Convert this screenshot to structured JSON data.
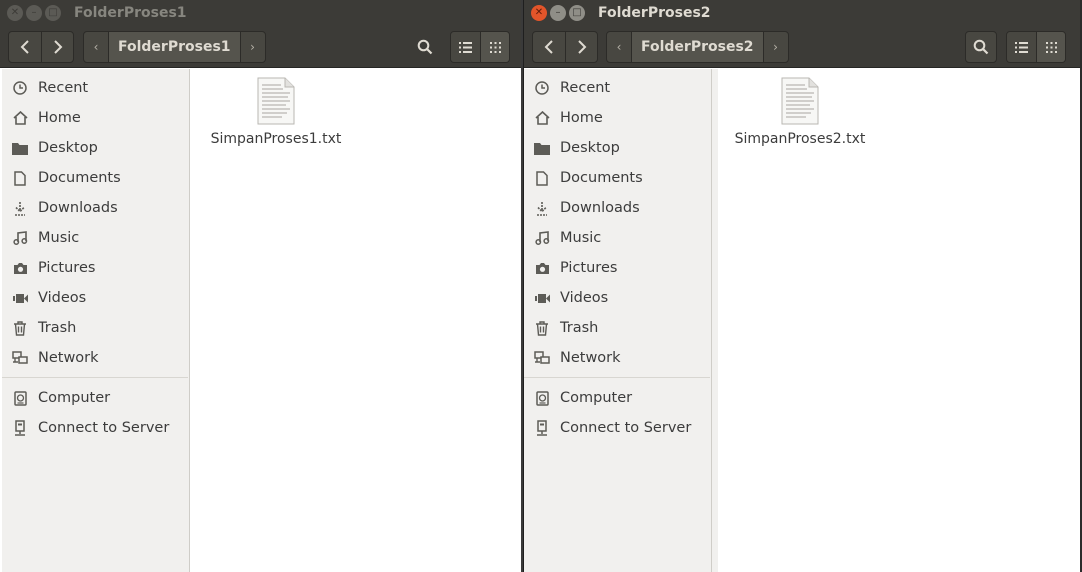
{
  "windows": [
    {
      "title": "FolderProses1",
      "active": false,
      "breadcrumb": "FolderProses1",
      "sidebar": [
        "Recent",
        "Home",
        "Desktop",
        "Documents",
        "Downloads",
        "Music",
        "Pictures",
        "Videos",
        "Trash",
        "Network"
      ],
      "sidebar_devices": [
        "Computer",
        "Connect to Server"
      ],
      "files": [
        {
          "name": "SimpanProses1.txt",
          "icon": "text-file-icon"
        }
      ]
    },
    {
      "title": "FolderProses2",
      "active": true,
      "breadcrumb": "FolderProses2",
      "sidebar": [
        "Recent",
        "Home",
        "Desktop",
        "Documents",
        "Downloads",
        "Music",
        "Pictures",
        "Videos",
        "Trash",
        "Network"
      ],
      "sidebar_devices": [
        "Computer",
        "Connect to Server"
      ],
      "files": [
        {
          "name": "SimpanProses2.txt",
          "icon": "text-file-icon"
        }
      ]
    }
  ],
  "icons": {
    "sidebar": [
      "clock-icon",
      "home-icon",
      "folder-icon",
      "document-icon",
      "download-icon",
      "music-icon",
      "camera-icon",
      "video-icon",
      "trash-icon",
      "network-icon"
    ],
    "devices": [
      "drive-icon",
      "server-icon"
    ]
  },
  "colors": {
    "titlebar": "#3c3b37",
    "close_active": "#e2552a",
    "sidebar_bg": "#f1f0ee",
    "content_bg": "#ffffff"
  }
}
